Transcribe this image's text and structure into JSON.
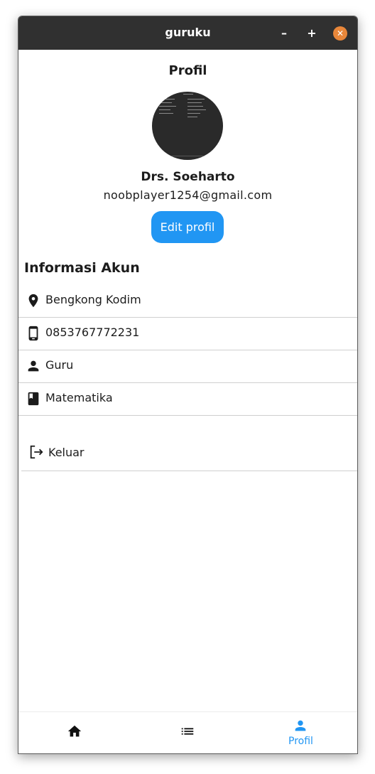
{
  "window": {
    "title": "guruku",
    "minimize_glyph": "–",
    "maximize_glyph": "+",
    "close_glyph": "✕"
  },
  "profile": {
    "page_title": "Profil",
    "name": "Drs. Soeharto",
    "email": "noobplayer1254@gmail.com",
    "edit_label": "Edit profil"
  },
  "account": {
    "section_title": "Informasi Akun",
    "items": [
      {
        "icon": "location-pin-icon",
        "value": "Bengkong Kodim"
      },
      {
        "icon": "phone-icon",
        "value": "0853767772231"
      },
      {
        "icon": "person-icon",
        "value": "Guru"
      },
      {
        "icon": "book-icon",
        "value": "Matematika"
      }
    ]
  },
  "logout": {
    "icon": "logout-icon",
    "label": "Keluar"
  },
  "bottom_nav": {
    "items": [
      {
        "icon": "home-icon",
        "label": ""
      },
      {
        "icon": "list-icon",
        "label": ""
      },
      {
        "icon": "person-icon",
        "label": "Profil",
        "active": true
      }
    ]
  },
  "colors": {
    "accent": "#2196f3",
    "titlebar": "#303030",
    "close_button": "#e9873a",
    "text": "#1c1c1c",
    "divider": "#cfcfcf"
  }
}
